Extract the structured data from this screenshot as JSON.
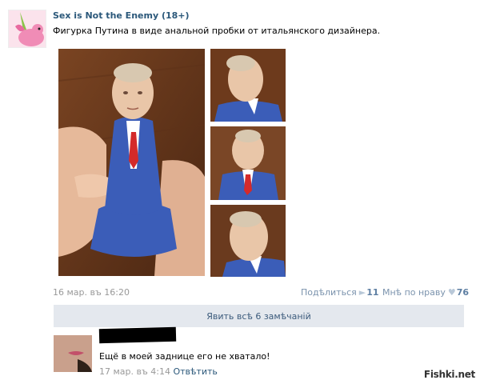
{
  "post": {
    "group_name": "Sex is Not the Enemy (18+)",
    "text": "Фигурка Путина в виде анальной пробки от итальянского дизайнера.",
    "date": "16 мар. въ 16:20",
    "share_label": "Подѣлиться",
    "share_count": "11",
    "like_label": "Мнѣ по нраву",
    "like_count": "76",
    "share_icon": "megaphone-icon",
    "like_icon": "heart-icon"
  },
  "comments": {
    "show_all_label": "Явить всѣ 6 замѣчаній",
    "items": [
      {
        "text": "Ещё в моей заднице его не хватало!",
        "date": "17 мар. въ 4:14",
        "reply_label": "Отвѣтить"
      }
    ]
  },
  "watermark": "Fishki.net",
  "colors": {
    "link": "#2b587a",
    "muted": "#999999",
    "bar_bg": "#e4e8ee",
    "suit_blue": "#3b5db8",
    "tie_red": "#d42a2a"
  }
}
